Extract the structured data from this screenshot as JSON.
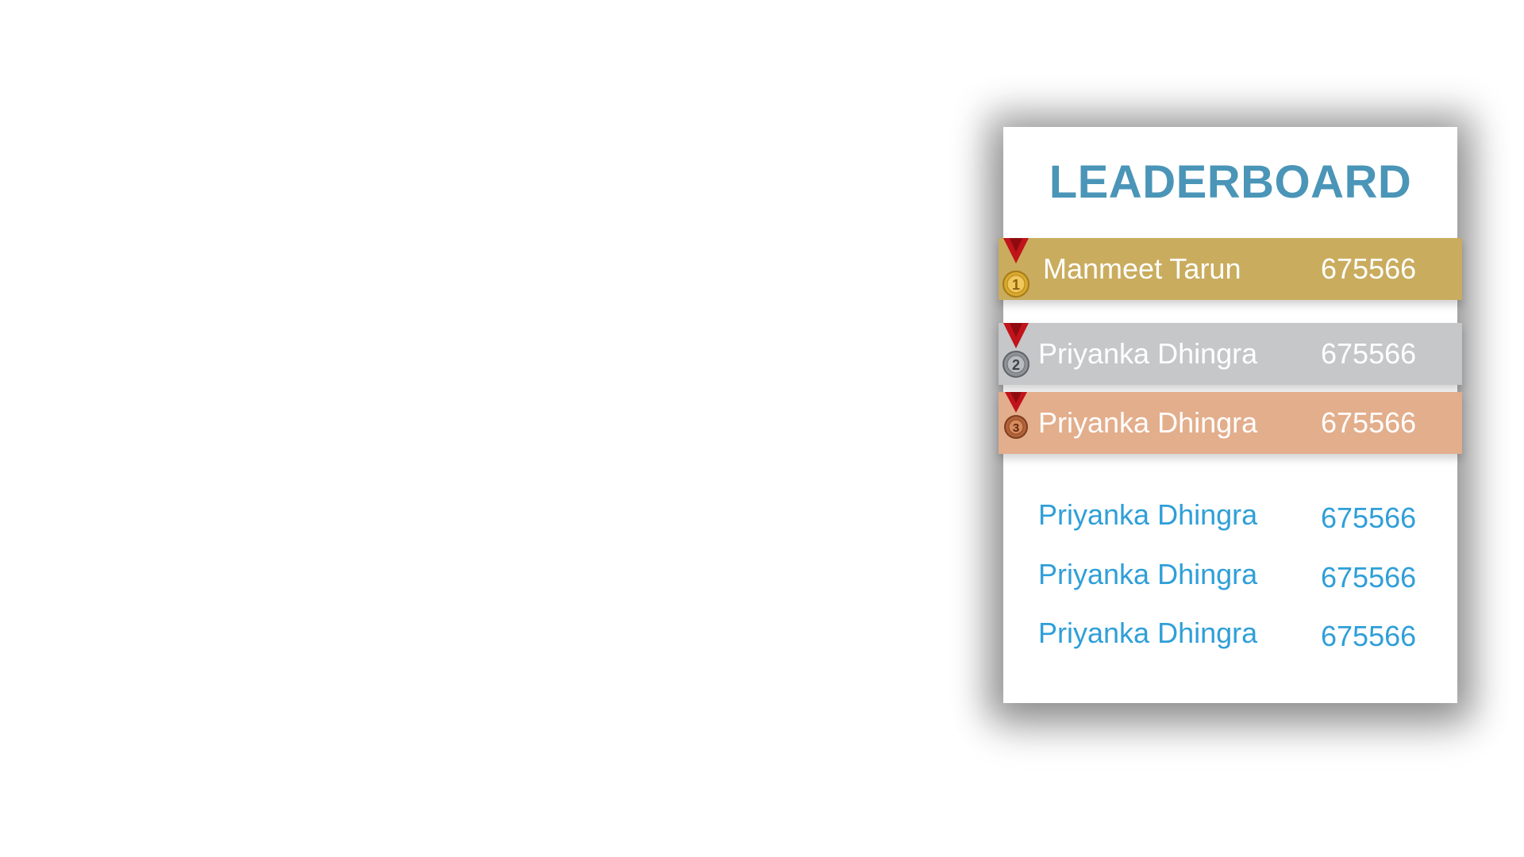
{
  "title": "LEADERBOARD",
  "podium": [
    {
      "rank": "1",
      "medal": "gold-medal-icon",
      "name": "Manmeet Tarun",
      "score": "675566",
      "color": "#c9ac5e"
    },
    {
      "rank": "2",
      "medal": "silver-medal-icon",
      "name": "Priyanka Dhingra",
      "score": "675566",
      "color": "#c6c7c9"
    },
    {
      "rank": "3",
      "medal": "bronze-medal-icon",
      "name": "Priyanka Dhingra",
      "score": "675566",
      "color": "#e3ae8c"
    }
  ],
  "others": [
    {
      "name": "Priyanka Dhingra",
      "score": "675566"
    },
    {
      "name": "Priyanka Dhingra",
      "score": "675566"
    },
    {
      "name": "Priyanka Dhingra",
      "score": "675566"
    }
  ],
  "colors": {
    "title": "#4a95b8",
    "list_text": "#2f9fd8",
    "ribbon": "#c0141a"
  }
}
